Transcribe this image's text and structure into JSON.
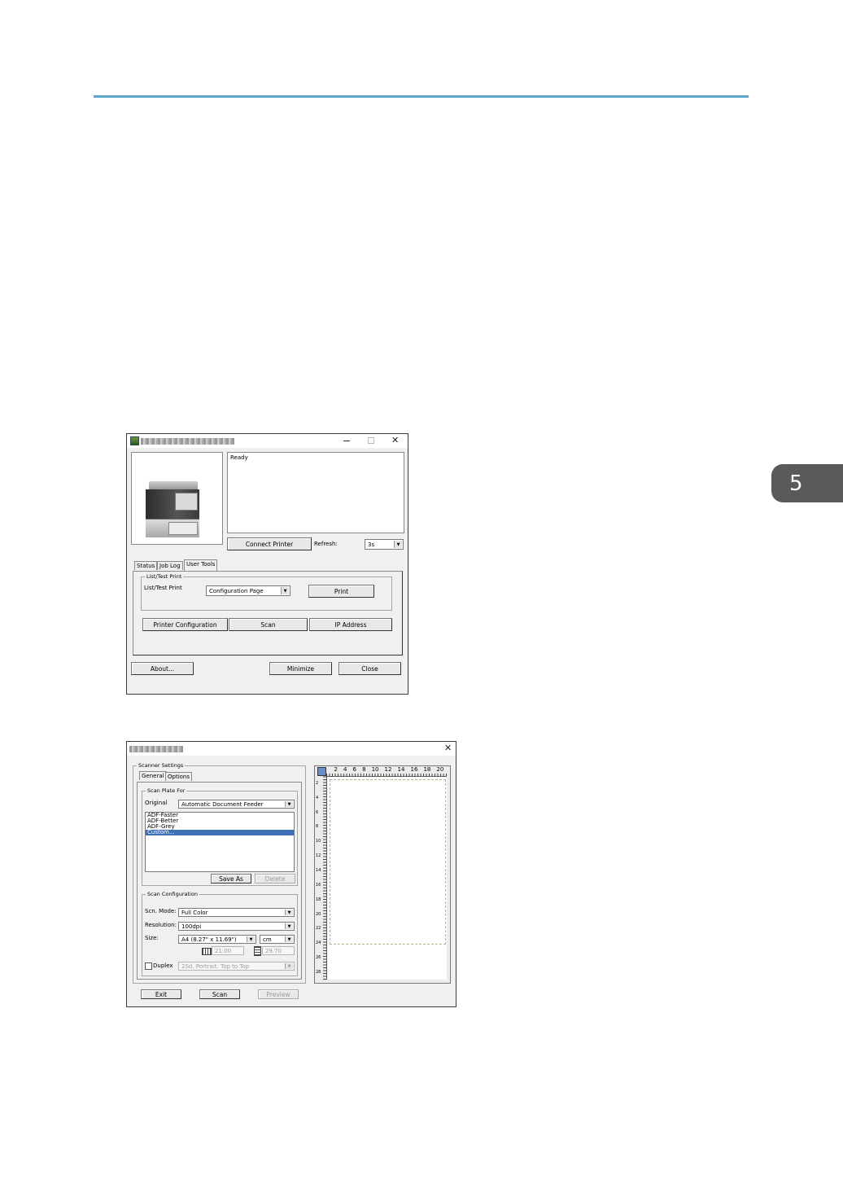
{
  "chapter": {
    "number": "5"
  },
  "status_window": {
    "status_text": "Ready",
    "connect_label": "Connect Printer",
    "refresh_label": "Refresh:",
    "refresh_value": "3s",
    "tabs": [
      "Status",
      "Job Log",
      "User Tools"
    ],
    "group_title": "List/Test Print",
    "list_label": "List/Test Print",
    "list_value": "Configuration Page",
    "print_label": "Print",
    "printer_config_label": "Printer Configuration",
    "scan_label": "Scan",
    "ip_label": "IP Address",
    "about_label": "About...",
    "minimize_label": "Minimize",
    "close_label": "Close"
  },
  "scanner_window": {
    "group_title": "Scanner Settings",
    "tabs": [
      "General",
      "Options"
    ],
    "scan_plate_title": "Scan Plate For",
    "original_label": "Original",
    "original_value": "Automatic Document Feeder",
    "presets": [
      "ADF-Faster",
      "ADF-Better",
      "ADF-Grey",
      "Custom..."
    ],
    "save_as_label": "Save As",
    "delete_label": "Delete",
    "config_title": "Scan Configuration",
    "mode_label": "Scn. Mode:",
    "mode_value": "Full Color",
    "resolution_label": "Resolution:",
    "resolution_value": "100dpi",
    "size_label": "Size:",
    "size_value": "A4 (8.27\" x 11.69\")",
    "unit_value": "cm",
    "width_value": "21.00",
    "height_value": "29.70",
    "duplex_label": "Duplex",
    "duplex_value": "2Sd. Portrait: Top to Top",
    "exit_label": "Exit",
    "scan_label": "Scan",
    "preview_label": "Preview",
    "ruler_top": [
      "2",
      "4",
      "6",
      "8",
      "10",
      "12",
      "14",
      "16",
      "18",
      "20"
    ],
    "ruler_left": [
      "2",
      "4",
      "6",
      "8",
      "10",
      "12",
      "14",
      "16",
      "18",
      "20",
      "22",
      "24",
      "26",
      "28"
    ]
  }
}
